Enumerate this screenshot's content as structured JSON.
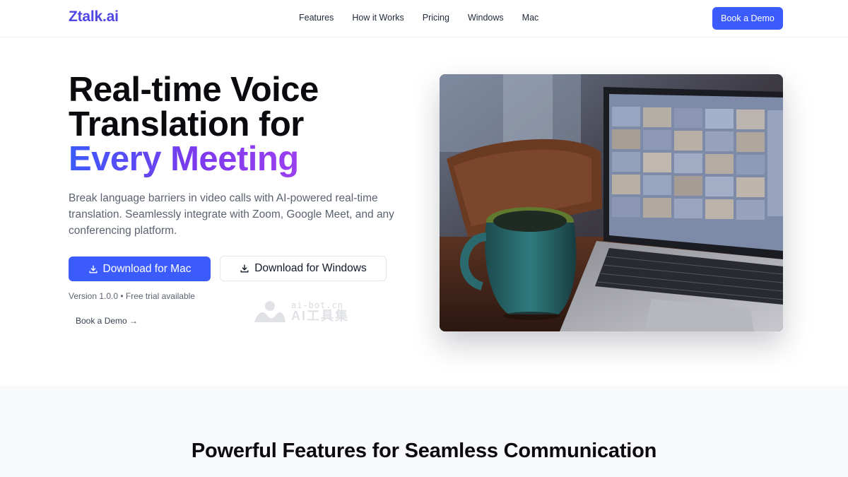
{
  "header": {
    "logo": "Ztalk.ai",
    "nav": [
      "Features",
      "How it Works",
      "Pricing",
      "Windows",
      "Mac"
    ],
    "cta": "Book a Demo"
  },
  "hero": {
    "title_line1": "Real-time Voice",
    "title_line2": "Translation for",
    "title_line3": "Every Meeting",
    "subtitle": "Break language barriers in video calls with AI-powered real-time translation. Seamlessly integrate with Zoom, Google Meet, and any conferencing platform.",
    "download_mac": "Download for Mac",
    "download_windows": "Download for Windows",
    "version": "Version 1.0.0 • Free trial available",
    "book_demo": "Book a Demo",
    "book_demo_arrow": "→",
    "download_icon": "download-icon",
    "image_icon": "meeting-photo"
  },
  "watermark": {
    "line1": "ai-bot.cn",
    "line2": "AI工具集"
  },
  "features": {
    "title": "Powerful Features for Seamless Communication"
  },
  "colors": {
    "brand": "#4f46e5",
    "primary_button": "#3b5bfd",
    "gradient_start": "#3b5bfd",
    "gradient_end": "#9b3ff0"
  }
}
